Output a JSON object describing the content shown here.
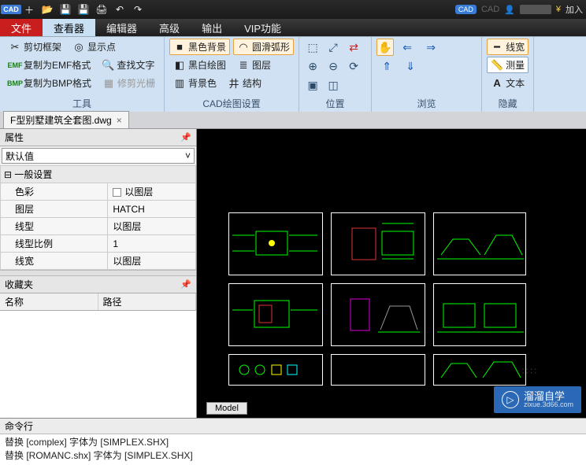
{
  "title_badge": "CAD",
  "titlebar_right": {
    "cad": "CAD",
    "cad_faded": "CAD",
    "yen": "¥",
    "join": "加入"
  },
  "menus": {
    "file": "文件",
    "viewer": "查看器",
    "editor": "编辑器",
    "advanced": "高级",
    "output": "输出",
    "vip": "VIP功能"
  },
  "ribbon": {
    "tools": {
      "cut_frame": "剪切框架",
      "copy_emf": "复制为EMF格式",
      "copy_bmp": "复制为BMP格式",
      "show_point": "显示点",
      "find_text": "查找文字",
      "trim_grating": "修剪光栅",
      "group": "工具"
    },
    "cad_set": {
      "black_bg": "黑色背景",
      "bw_plot": "黑白绘图",
      "bg_color": "背景色",
      "smooth_arc": "圆滑弧形",
      "layer": "图层",
      "structure": "结构",
      "group": "CAD绘图设置"
    },
    "pos_group": "位置",
    "browse_group": "浏览",
    "hide": {
      "linewidth": "线宽",
      "measure": "测量",
      "text": "文本",
      "group": "隐藏"
    }
  },
  "doc_tab": "F型别墅建筑全套图.dwg",
  "panel": {
    "props_title": "属性",
    "default": "默认值",
    "section_general": "一般设置",
    "rows": {
      "color": "色彩",
      "color_v": "以图层",
      "layer": "图层",
      "layer_v": "HATCH",
      "linetype": "线型",
      "linetype_v": "以图层",
      "ltscale": "线型比例",
      "ltscale_v": "1",
      "lineweight": "线宽",
      "lineweight_v": "以图层"
    },
    "fav_title": "收藏夹",
    "fav_name": "名称",
    "fav_path": "路径"
  },
  "canvas": {
    "model_tab": "Model"
  },
  "watermark": {
    "t1": "溜溜自学",
    "t2": "zixue.3d66.com"
  },
  "cmd": {
    "title": "命令行",
    "line1": "替换 [complex] 字体为 [SIMPLEX.SHX]",
    "line2": "替换 [ROMANC.shx] 字体为 [SIMPLEX.SHX]"
  }
}
